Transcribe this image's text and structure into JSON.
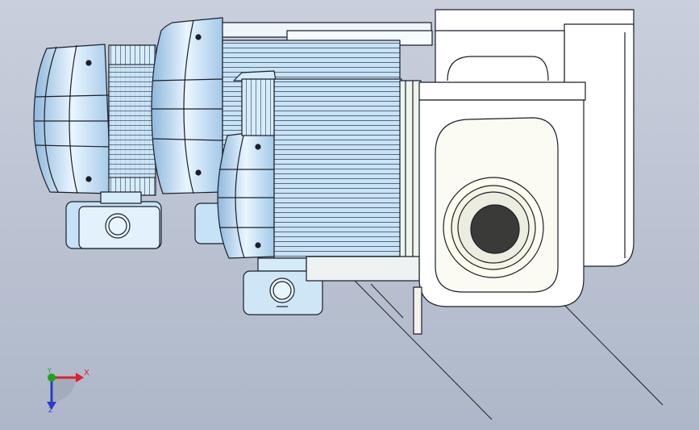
{
  "triad": {
    "x_label": "X",
    "y_label": "Y",
    "z_label": "Z",
    "x_color": "#e0202a",
    "y_color": "#1aa61a",
    "z_color": "#2a3cc8",
    "x_icon": "arrow-right-icon",
    "y_icon": "dot-icon",
    "z_icon": "arrow-down-icon"
  },
  "colors": {
    "background_top": "#c9cfdc",
    "background_bottom": "#aeb7c9",
    "motor_fill": "#b7d8f0",
    "motor_highlight": "#eaf6ff",
    "outline": "#1b1f28",
    "gearbox_fill": "#ffffff",
    "output_hole": "#3a3a38"
  }
}
